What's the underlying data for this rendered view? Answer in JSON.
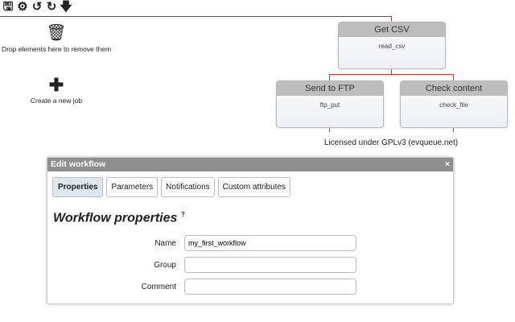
{
  "toolbar": {
    "icons": [
      "save-icon",
      "gear-icon",
      "undo-icon",
      "redo-icon",
      "download-icon"
    ],
    "save": "🖫",
    "settings": "⚙",
    "undo": "↺",
    "redo": "↻",
    "download": "🡇"
  },
  "trash": {
    "icon": "🗑",
    "label": "Drop elements here to remove them"
  },
  "create": {
    "icon": "✚",
    "label": "Create a new job"
  },
  "jobs": [
    {
      "title": "Get CSV",
      "task": "read_csv"
    },
    {
      "title": "Send to FTP",
      "task": "ftp_put"
    },
    {
      "title": "Check content",
      "task": "check_file"
    }
  ],
  "license": "Licensed under GPLv3 (evqueue.net)",
  "dialog": {
    "title": "Edit workflow",
    "close": "×",
    "tabs": [
      "Properties",
      "Parameters",
      "Notifications",
      "Custom attributes"
    ],
    "heading": "Workflow properties",
    "help": "?",
    "fields": [
      {
        "label": "Name",
        "value": "my_first_workflow"
      },
      {
        "label": "Group",
        "value": ""
      },
      {
        "label": "Comment",
        "value": ""
      }
    ]
  }
}
